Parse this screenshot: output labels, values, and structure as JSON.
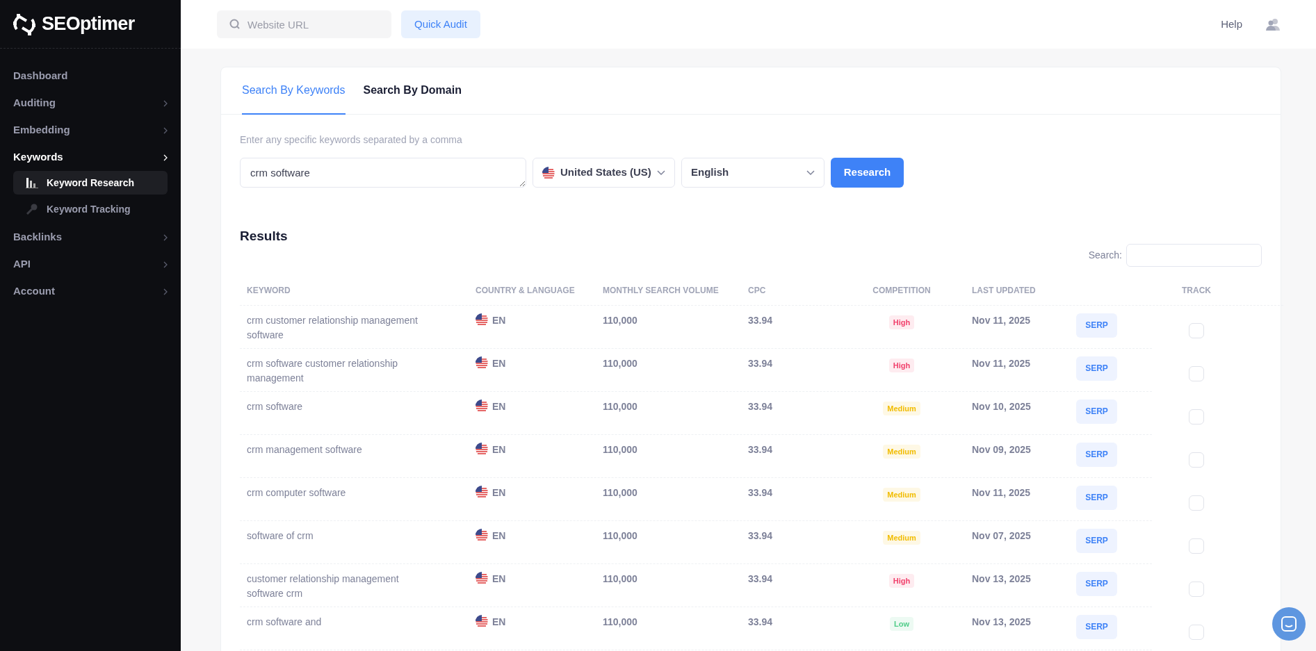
{
  "brand": {
    "name": "SEOptimer"
  },
  "sidebar": {
    "items": [
      {
        "label": "Dashboard",
        "kind": "link",
        "expanded": false
      },
      {
        "label": "Auditing",
        "kind": "group",
        "expanded": false
      },
      {
        "label": "Embedding",
        "kind": "group",
        "expanded": false
      },
      {
        "label": "Keywords",
        "kind": "group",
        "expanded": true,
        "children": [
          {
            "label": "Keyword Research",
            "selected": true
          },
          {
            "label": "Keyword Tracking",
            "selected": false
          }
        ]
      },
      {
        "label": "Backlinks",
        "kind": "group",
        "expanded": false
      },
      {
        "label": "API",
        "kind": "group",
        "expanded": false
      },
      {
        "label": "Account",
        "kind": "group",
        "expanded": false
      }
    ]
  },
  "header": {
    "url_field": {
      "placeholder": "Website URL"
    },
    "audit_button": "Quick Audit",
    "help": "Help"
  },
  "tabs": [
    {
      "label": "Search By Keywords",
      "selected": true
    },
    {
      "label": "Search By Domain",
      "selected": false
    }
  ],
  "form": {
    "hint": "Enter any specific keywords separated by a comma",
    "keywords": "crm software",
    "country": "United States (US)",
    "language": "English",
    "button": "Research"
  },
  "results": {
    "title": "Results",
    "search_label": "Search:",
    "columns": [
      "KEYWORD",
      "COUNTRY & LANGUAGE",
      "MONTHLY SEARCH VOLUME",
      "CPC",
      "COMPETITION",
      "LAST UPDATED",
      "TRACK"
    ],
    "rows": [
      {
        "keyword": "crm customer relationship management software",
        "language": "EN",
        "volume": "110,000",
        "cpc": "33.94",
        "competition": "High",
        "color": "#f1416c",
        "updated": "Nov 11, 2025",
        "serp": "SERP",
        "tracked": false
      },
      {
        "keyword": "crm software customer relationship management",
        "language": "EN",
        "volume": "110,000",
        "cpc": "33.94",
        "competition": "High",
        "color": "#f1416c",
        "updated": "Nov 11, 2025",
        "serp": "SERP",
        "tracked": false
      },
      {
        "keyword": "crm software",
        "language": "EN",
        "volume": "110,000",
        "cpc": "33.94",
        "competition": "Medium",
        "color": "#f1bc00",
        "updated": "Nov 10, 2025",
        "serp": "SERP",
        "tracked": false
      },
      {
        "keyword": "crm management software",
        "language": "EN",
        "volume": "110,000",
        "cpc": "33.94",
        "competition": "Medium",
        "color": "#f1bc00",
        "updated": "Nov 09, 2025",
        "serp": "SERP",
        "tracked": false
      },
      {
        "keyword": "crm computer software",
        "language": "EN",
        "volume": "110,000",
        "cpc": "33.94",
        "competition": "Medium",
        "color": "#f1bc00",
        "updated": "Nov 11, 2025",
        "serp": "SERP",
        "tracked": false
      },
      {
        "keyword": "software of crm",
        "language": "EN",
        "volume": "110,000",
        "cpc": "33.94",
        "competition": "Medium",
        "color": "#f1bc00",
        "updated": "Nov 07, 2025",
        "serp": "SERP",
        "tracked": false
      },
      {
        "keyword": "customer relationship management software crm",
        "language": "EN",
        "volume": "110,000",
        "cpc": "33.94",
        "competition": "High",
        "color": "#f1416c",
        "updated": "Nov 13, 2025",
        "serp": "SERP",
        "tracked": false
      },
      {
        "keyword": "crm software and",
        "language": "EN",
        "volume": "110,000",
        "cpc": "33.94",
        "competition": "Low",
        "color": "#50cd89",
        "updated": "Nov 13, 2025",
        "serp": "SERP",
        "tracked": false
      }
    ]
  }
}
